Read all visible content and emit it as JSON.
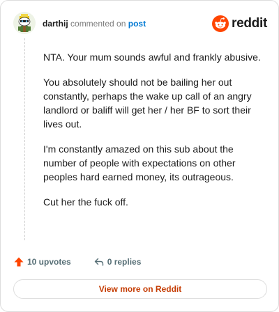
{
  "header": {
    "username": "darthij",
    "action_text": "commented on",
    "post_link": "post",
    "logo_text": "reddit"
  },
  "comment": {
    "paragraphs": [
      "NTA. Your mum sounds awful and frankly abusive.",
      "You absolutely should not be bailing her out constantly, perhaps the wake up call of an angry landlord or baliff will get her / her BF to sort their lives out.",
      "I'm constantly amazed on this sub about the number of people with expectations on other peoples hard earned money, its outrageous.",
      "Cut her the fuck off."
    ]
  },
  "actions": {
    "upvotes": "10 upvotes",
    "replies": "0 replies"
  },
  "footer": {
    "view_more": "View more on Reddit"
  },
  "colors": {
    "reddit_orange": "#ff4500",
    "link_blue": "#0079d3",
    "view_more_text": "#c43a00"
  },
  "icons": {
    "avatar": "snoo-avatar",
    "logo": "reddit-logo-icon",
    "upvote": "upvote-arrow-icon",
    "reply": "reply-arrow-icon"
  }
}
